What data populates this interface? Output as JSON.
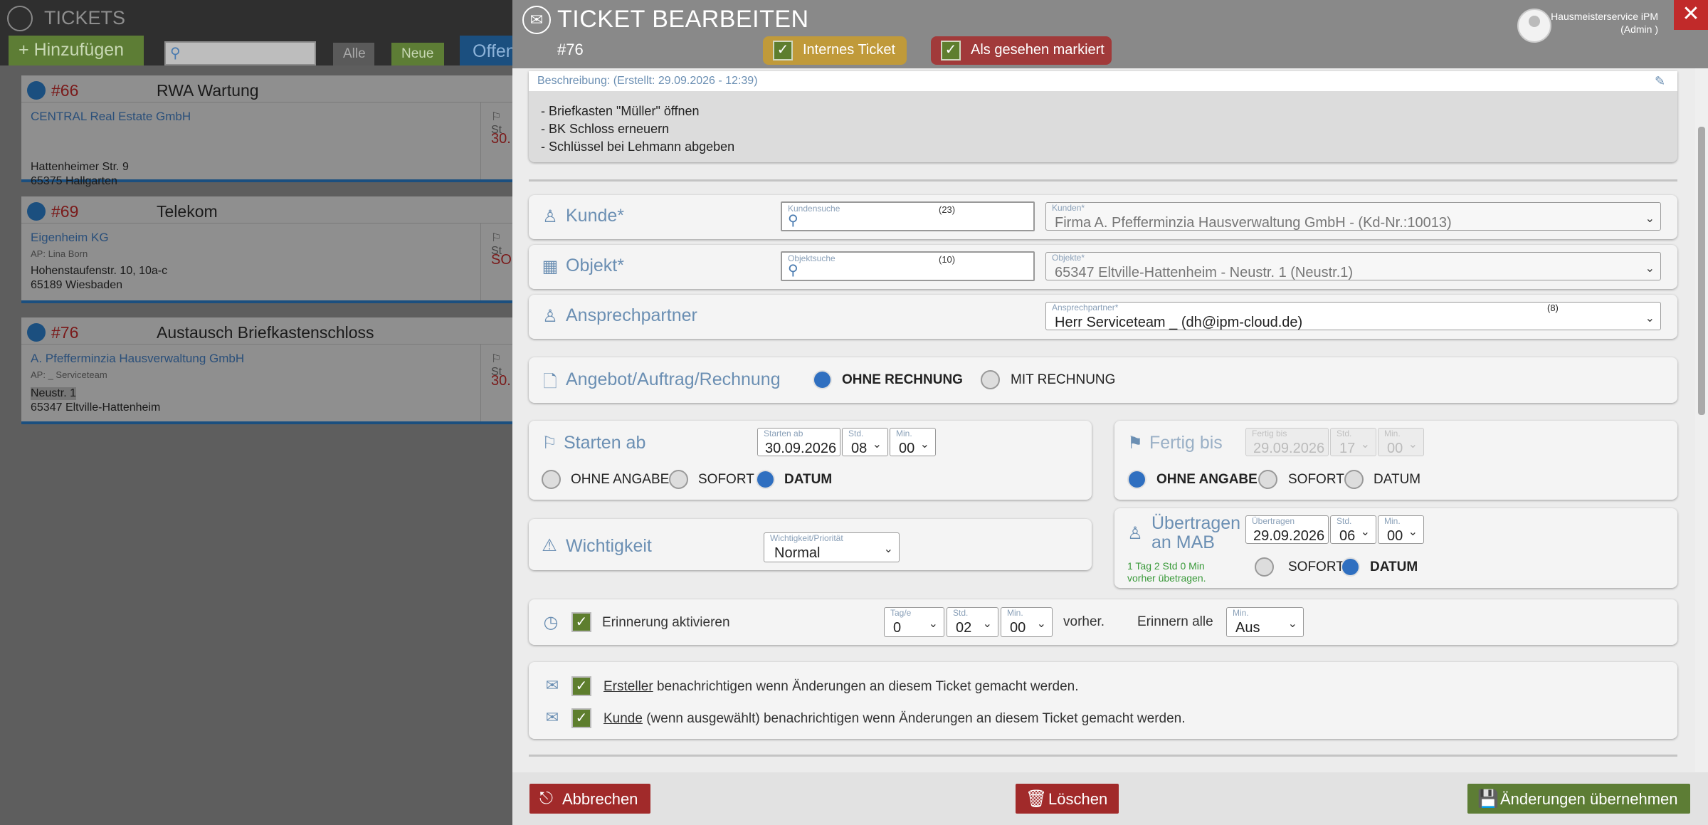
{
  "background": {
    "app_title": "TICKETS",
    "add_button": "Hinzufügen",
    "filters": [
      "Alle",
      "Neue",
      "Offen"
    ],
    "tickets": [
      {
        "number": "#66",
        "title": "RWA Wartung",
        "customer": "CENTRAL Real Estate GmbH",
        "contact": "",
        "lines": [
          "Hattenheimer Str. 9",
          "65375 Hallgarten"
        ],
        "start_label": "St",
        "date": "30."
      },
      {
        "number": "#69",
        "title": "Telekom",
        "customer": "Eigenheim KG",
        "contact": "AP: Lina Born",
        "lines": [
          "Hohenstaufenstr. 10, 10a-c",
          "65189 Wiesbaden"
        ],
        "start_label": "St",
        "date": "SOF"
      },
      {
        "number": "#76",
        "title": "Austausch Briefkastenschloss",
        "customer": "A. Pfefferminzia Hausverwaltung GmbH",
        "contact": "AP: _ Serviceteam",
        "lines": [
          "Neustr. 1",
          "65347 Eltville-Hattenheim"
        ],
        "start_label": "St",
        "date": "30."
      }
    ]
  },
  "modal": {
    "title": "TICKET BEARBEITEN",
    "ticket_number": "#76",
    "internal_ticket_label": "Internes Ticket",
    "seen_label": "Als gesehen markiert",
    "user_name": "Hausmeisterservice iPM",
    "user_role": "(Admin )",
    "close_glyph": "✕",
    "description": {
      "label": "Beschreibung: (Erstellt: 29.09.2026 - 12:39)",
      "lines": [
        "- Briefkasten \"Müller\" öffnen",
        "- BK Schloss erneuern",
        "- Schlüssel bei Lehmann abgeben"
      ]
    },
    "kunde": {
      "label": "Kunde*",
      "search_label": "Kundensuche",
      "search_count": "(23)",
      "select_label": "Kunden*",
      "select_value": "Firma A. Pfefferminzia Hausverwaltung GmbH - (Kd-Nr.:10013)"
    },
    "objekt": {
      "label": "Objekt*",
      "search_label": "Objektsuche",
      "search_count": "(10)",
      "select_label": "Objekte*",
      "select_value": "65347 Eltville-Hattenheim - Neustr. 1 (Neustr.1)"
    },
    "ansprechpartner": {
      "label": "Ansprechpartner",
      "select_label": "Ansprechpartner*",
      "count": "(8)",
      "select_value": "Herr Serviceteam _ (dh@ipm-cloud.de)"
    },
    "rechnung": {
      "label": "Angebot/Auftrag/Rechnung",
      "options": [
        "OHNE RECHNUNG",
        "MIT RECHNUNG"
      ],
      "selected": "OHNE RECHNUNG"
    },
    "starten": {
      "label": "Starten ab",
      "date_label": "Starten ab",
      "date": "30.09.2026",
      "hour_label": "Std.",
      "hour": "08",
      "min_label": "Min.",
      "min": "00",
      "options": [
        "OHNE ANGABE",
        "SOFORT",
        "DATUM"
      ],
      "selected": "DATUM"
    },
    "fertig": {
      "label": "Fertig bis",
      "date_label": "Fertig bis",
      "date": "29.09.2026",
      "hour_label": "Std.",
      "hour": "17",
      "min_label": "Min.",
      "min": "00",
      "options": [
        "OHNE ANGABE",
        "SOFORT",
        "DATUM"
      ],
      "selected": "OHNE ANGABE"
    },
    "wichtigkeit": {
      "label": "Wichtigkeit",
      "select_label": "Wichtigkeit/Priorität",
      "value": "Normal"
    },
    "uebertragen": {
      "label_line1": "Übertragen",
      "label_line2": "an MAB",
      "date_label": "Übertragen",
      "date": "29.09.2026",
      "hour_label": "Std.",
      "hour": "06",
      "min_label": "Min.",
      "min": "00",
      "note_line1": "1 Tag 2 Std 0 Min",
      "note_line2": "vorher übetragen.",
      "options": [
        "SOFORT",
        "DATUM"
      ],
      "selected": "DATUM"
    },
    "erinnerung": {
      "label": "Erinnerung aktivieren",
      "days_label": "Tag/e",
      "days": "0",
      "hours_label": "Std.",
      "hours": "02",
      "mins_label": "Min.",
      "mins": "00",
      "before": "vorher.",
      "every_label": "Erinnern alle",
      "every_mini": "Min.",
      "every_value": "Aus"
    },
    "notify": {
      "creator_link": "Ersteller",
      "creator_text": "benachrichtigen wenn Änderungen an diesem Ticket gemacht werden.",
      "customer_link": "Kunde",
      "customer_text": "(wenn ausgewählt) benachrichtigen wenn Änderungen an diesem Ticket gemacht werden."
    },
    "footer": {
      "cancel": "Abbrechen",
      "delete": "Löschen",
      "save": "Änderungen übernehmen"
    }
  },
  "colors": {
    "accent_blue": "#6b8fb3",
    "radio_blue": "#2f6fc0",
    "danger_red": "#a12a2a",
    "success_green": "#5d7d35",
    "warning_gold": "#c09a3a"
  }
}
